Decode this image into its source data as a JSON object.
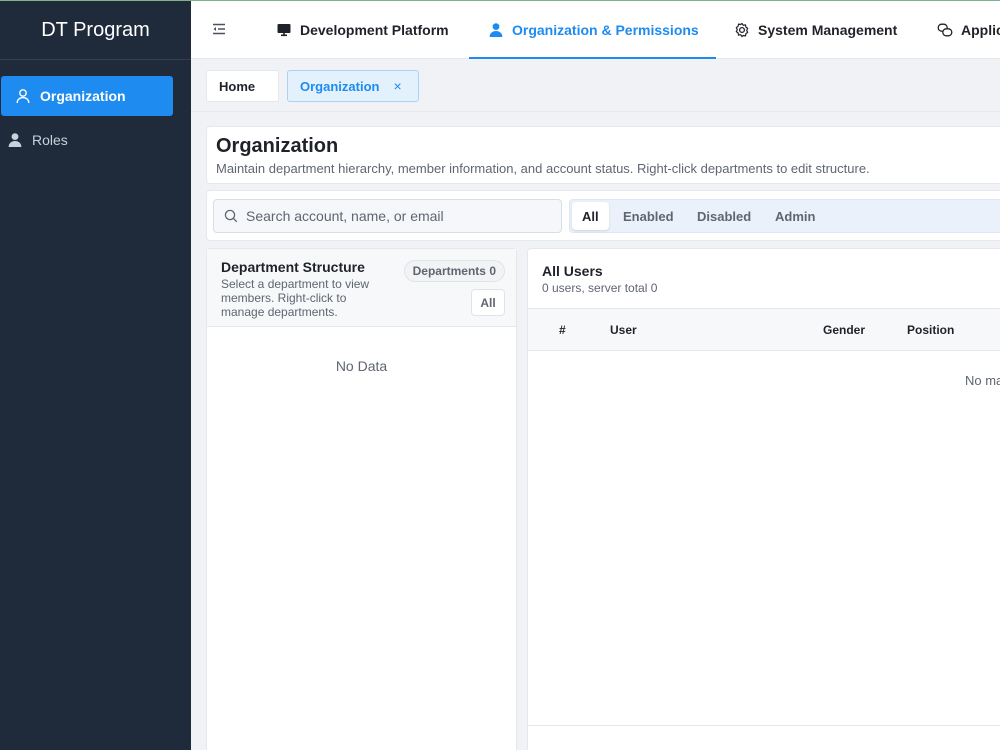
{
  "sidebar": {
    "brand": "DT Program",
    "items": [
      {
        "label": "Organization",
        "icon": "user-icon",
        "active": true
      },
      {
        "label": "Roles",
        "icon": "user-filled-icon",
        "active": false
      }
    ]
  },
  "topnav": {
    "tabs": [
      {
        "label": "Development Platform",
        "icon": "monitor-icon"
      },
      {
        "label": "Organization & Permissions",
        "icon": "user-filled-icon",
        "active": true
      },
      {
        "label": "System Management",
        "icon": "gear-icon"
      },
      {
        "label": "Applic",
        "icon": "chat-icon"
      }
    ]
  },
  "tags": {
    "home": "Home",
    "current": "Organization",
    "close": "×"
  },
  "page": {
    "title": "Organization",
    "description": "Maintain department hierarchy, member information, and account status. Right-click departments to edit structure."
  },
  "filters": {
    "search_placeholder": "Search account, name, or email",
    "segments": [
      "All",
      "Enabled",
      "Disabled",
      "Admin"
    ],
    "active_segment": "All"
  },
  "departments": {
    "title": "Department Structure",
    "subtitle": "Select a department to view members. Right-click to manage departments.",
    "count_label": "Departments 0",
    "all_button": "All",
    "empty": "No Data"
  },
  "users": {
    "title": "All Users",
    "subtitle": "0 users, server total 0",
    "columns": [
      "#",
      "User",
      "Gender",
      "Position"
    ],
    "empty": "No ma"
  },
  "colors": {
    "accent": "#1e8bf0",
    "sidebar_bg": "#1f2a3a",
    "page_bg": "#f0f2f5"
  }
}
